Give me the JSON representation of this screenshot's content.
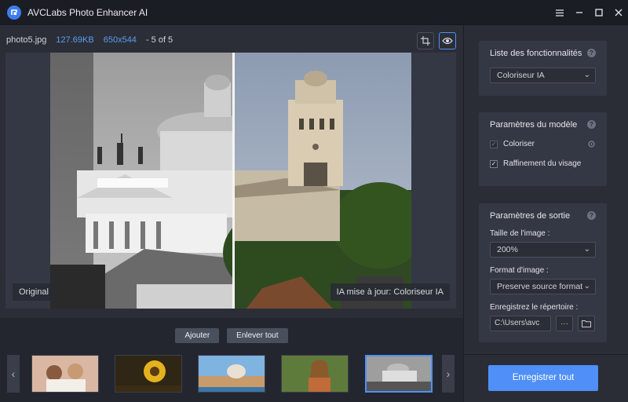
{
  "window": {
    "title": "AVCLabs Photo Enhancer AI"
  },
  "file_info": {
    "name": "photo5.jpg",
    "size": "127.69KB",
    "dimensions": "650x544",
    "counter": "- 5 of 5"
  },
  "preview": {
    "label_original": "Original",
    "label_processed": "IA mise à jour: Coloriseur IA"
  },
  "actions": {
    "add": "Ajouter",
    "remove_all": "Enlever tout"
  },
  "features": {
    "title": "Liste des fonctionnalités",
    "selected": "Coloriseur IA"
  },
  "model": {
    "title": "Paramètres du modèle",
    "opt1": "Coloriser",
    "opt2": "Raffinement du visage"
  },
  "output": {
    "title": "Paramètres de sortie",
    "size_label": "Taille de l'image :",
    "size_value": "200%",
    "format_label": "Format d'image :",
    "format_value": "Preserve source format",
    "dir_label": "Enregistrez le répertoire :",
    "dir_value": "C:\\Users\\avc"
  },
  "save_all": "Enregistrer tout",
  "colors": {
    "accent": "#4f8ff7",
    "bg": "#2b2e37",
    "panel": "#343844"
  }
}
